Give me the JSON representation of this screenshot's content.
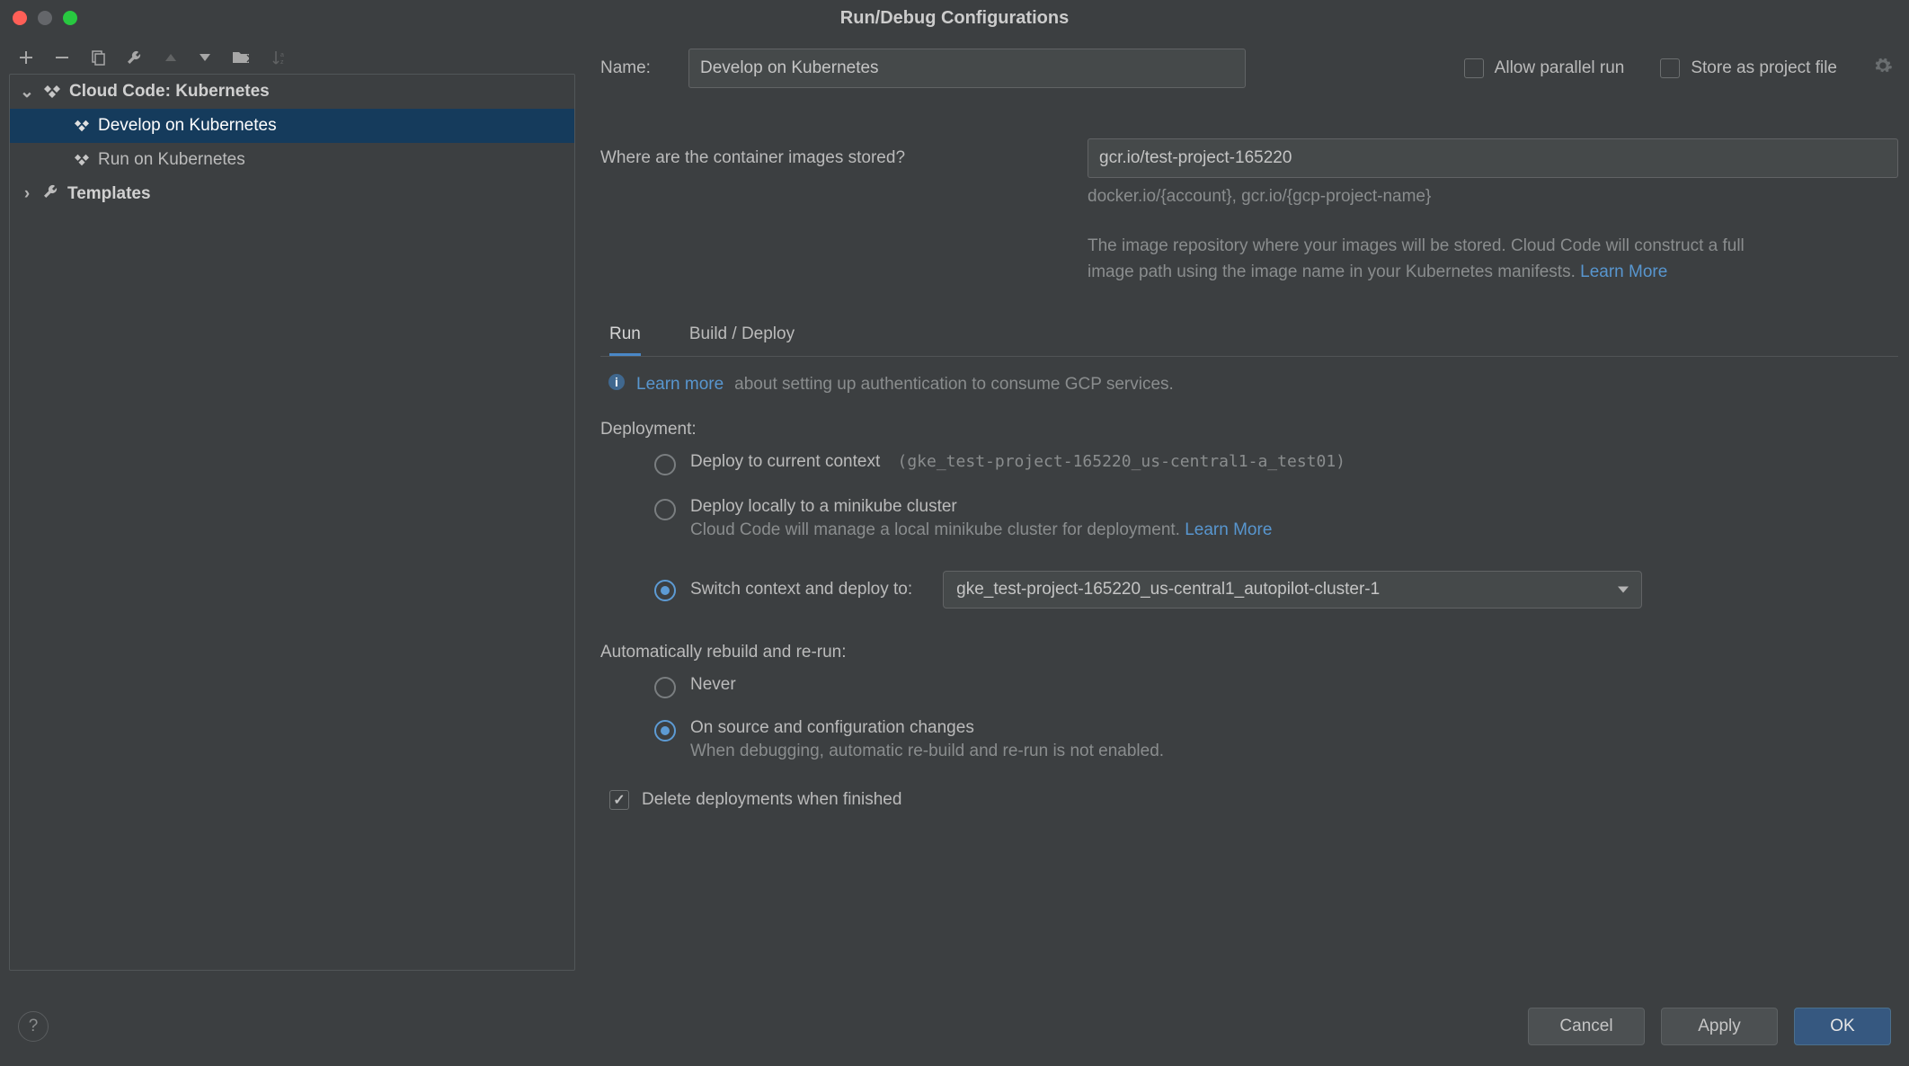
{
  "window": {
    "title": "Run/Debug Configurations"
  },
  "sidebar": {
    "category": "Cloud Code: Kubernetes",
    "items": {
      "develop": "Develop on Kubernetes",
      "run": "Run on Kubernetes"
    },
    "templates": "Templates"
  },
  "form": {
    "name_label": "Name:",
    "name_value": "Develop on Kubernetes",
    "allow_parallel": "Allow parallel run",
    "store_as_project": "Store as project file",
    "images_label": "Where are the container images stored?",
    "images_value": "gcr.io/test-project-165220",
    "images_hint": "docker.io/{account}, gcr.io/{gcp-project-name}",
    "repo_desc": "The image repository where your images will be stored. Cloud Code will construct a full image path using the image name in your Kubernetes manifests. ",
    "learn_more": "Learn More"
  },
  "tabs": {
    "run": "Run",
    "build": "Build / Deploy"
  },
  "info": {
    "learn_more": "Learn more",
    "text": " about setting up authentication to consume GCP services."
  },
  "deployment": {
    "heading": "Deployment:",
    "current": "Deploy to current context",
    "current_ctx": "(gke_test-project-165220_us-central1-a_test01)",
    "local": "Deploy locally to a minikube cluster",
    "local_sub": "Cloud Code will manage a local minikube cluster for deployment. ",
    "local_learn": "Learn More",
    "switch": "Switch context and deploy to:",
    "switch_value": "gke_test-project-165220_us-central1_autopilot-cluster-1"
  },
  "rebuild": {
    "heading": "Automatically rebuild and re-run:",
    "never": "Never",
    "onchange": "On source and configuration changes",
    "onchange_sub": "When debugging, automatic re-build and re-run is not enabled."
  },
  "delete_label": "Delete deployments when finished",
  "buttons": {
    "cancel": "Cancel",
    "apply": "Apply",
    "ok": "OK"
  }
}
